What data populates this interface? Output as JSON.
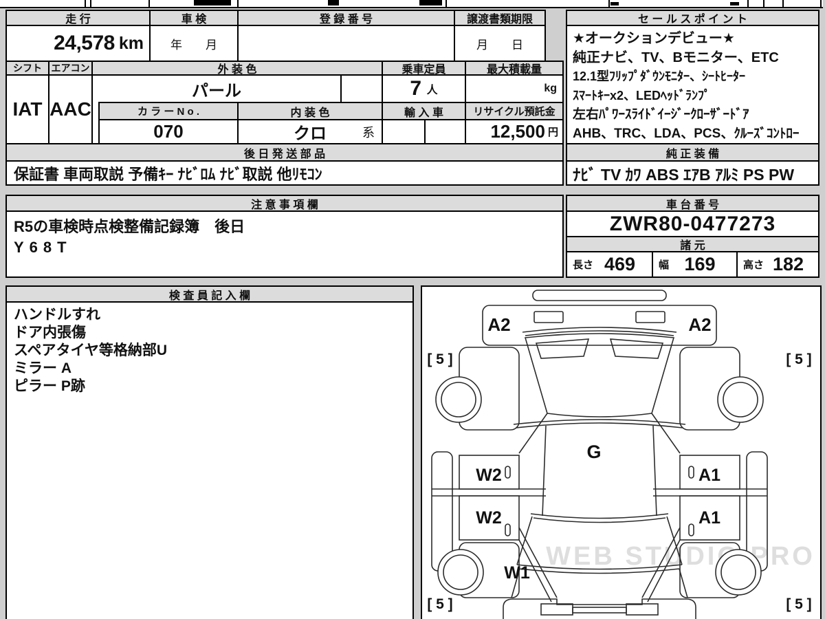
{
  "colors": {
    "page_bg": "#cfcfcf",
    "header_bg": "#dcdcdc",
    "border": "#000000",
    "diagram_line": "#2b2b2b",
    "watermark_color": "#dedede"
  },
  "top_table": {
    "mileage_label": "走 行",
    "mileage_value": "24,578",
    "mileage_unit": "km",
    "inspection_label": "車 検",
    "inspection_value": "年　　月",
    "registration_label": "登 録 番 号",
    "registration_value": "",
    "transfer_label": "譲渡書類期限",
    "transfer_value": "月　　日"
  },
  "spec_table": {
    "shift_label": "シフト",
    "shift_value": "IAT",
    "aircon_label": "エアコン",
    "aircon_value": "AAC",
    "exterior_label": "外 装 色",
    "exterior_value": "パール",
    "capacity_label": "乗車定員",
    "capacity_value": "7",
    "capacity_unit": "人",
    "max_load_label": "最大積載量",
    "max_load_unit": "kg",
    "color_no_label": "カ ラ ー N o .",
    "color_no_value": "070",
    "interior_label": "内 装 色",
    "interior_value": "クロ",
    "interior_suffix": "系",
    "import_label": "輸 入 車",
    "recycle_label": "リサイクル預託金",
    "recycle_value": "12,500",
    "recycle_unit": "円"
  },
  "shipped_parts": {
    "title": "後 日 発 送 部 品",
    "value": "保証書 車両取説 予備ｷｰ ﾅﾋﾞﾛﾑ ﾅﾋﾞ取説 他ﾘﾓｺﾝ"
  },
  "sales_points": {
    "title": "セ ー ル ス ポ イ ン ト",
    "lines": [
      "★オークションデビュー★",
      "純正ナビ、TV、Bモニター、ETC",
      "12.1型ﾌﾘｯﾌﾟﾀﾞｳﾝﾓﾆﾀｰ、ｼｰﾄﾋｰﾀｰ",
      "ｽﾏｰﾄｷｰx2、LEDﾍｯﾄﾞﾗﾝﾌﾟ",
      "左右ﾊﾟﾜｰｽﾗｲﾄﾞｲｰｼﾞｰｸﾛｰｻﾞｰﾄﾞｱ",
      "AHB、TRC、LDA、PCS、ｸﾙｰｽﾞｺﾝﾄﾛｰ"
    ]
  },
  "genuine_equipment": {
    "title": "純 正 装 備",
    "value": "ﾅﾋﾞ TV ｶﾜ ABS ｴｱB ｱﾙﾐ PS PW"
  },
  "notes": {
    "title": "注 意 事 項 欄",
    "line1": "R5の車検時点検整備記録簿　後日",
    "line2": "Y68T"
  },
  "chassis": {
    "title": "車 台 番 号",
    "value": "ZWR80-0477273"
  },
  "dimensions": {
    "title": "諸 元",
    "items": [
      {
        "label": "長さ",
        "value": "469"
      },
      {
        "label": "幅",
        "value": "169"
      },
      {
        "label": "高さ",
        "value": "182"
      }
    ]
  },
  "inspector": {
    "title": "検 査 員 記 入 欄",
    "lines": [
      "ハンドルすれ",
      "ドア内張傷",
      "スペアタイヤ等格納部U",
      "ミラー A",
      "ピラー P跡"
    ]
  },
  "diagram": {
    "hood_left": "A2",
    "hood_right": "A2",
    "tire_front_left": "[ 5 ]",
    "tire_front_right": "[ 5 ]",
    "tire_rear_left": "[ 5 ]",
    "tire_rear_right": "[ 5 ]",
    "roof": "G",
    "door_front_left": "W2",
    "door_rear_left": "W2",
    "door_front_right": "A1",
    "door_rear_right": "A1",
    "quarter_rear_left": "W1"
  },
  "watermark": "WEB STUDIO.PRO"
}
